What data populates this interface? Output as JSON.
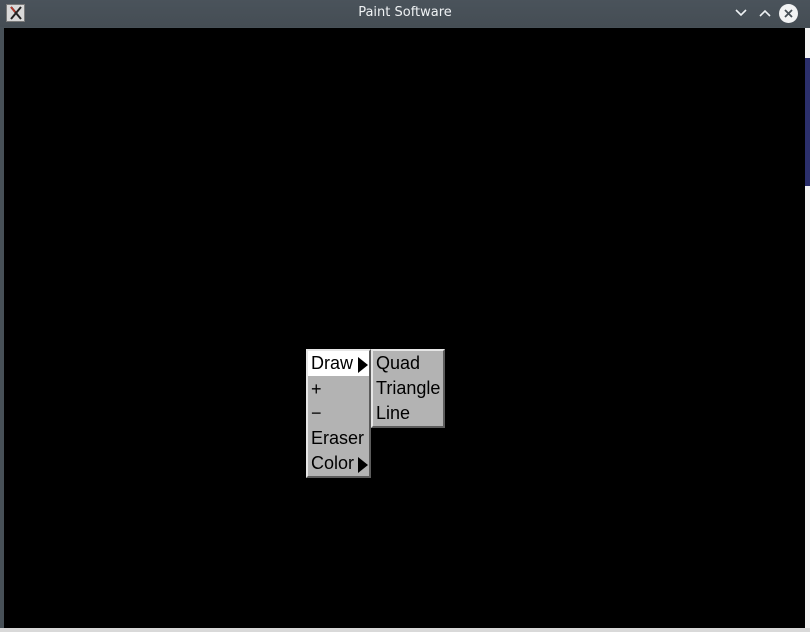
{
  "window": {
    "title": "Paint Software",
    "icon": "x-window-icon",
    "controls": [
      "minimize-icon",
      "maximize-icon",
      "close-icon"
    ]
  },
  "menu": {
    "items": [
      {
        "label": "Draw",
        "has_submenu": true,
        "selected": true
      },
      {
        "label": "+",
        "has_submenu": false
      },
      {
        "label": "−",
        "has_submenu": false
      },
      {
        "label": "Eraser",
        "has_submenu": false
      },
      {
        "label": "Color",
        "has_submenu": true
      }
    ]
  },
  "submenu": {
    "parent": "Draw",
    "items": [
      {
        "label": "Quad"
      },
      {
        "label": "Triangle"
      },
      {
        "label": "Line"
      }
    ]
  },
  "colors": {
    "canvas": "#000000",
    "menu_bg": "#b3b3b3",
    "menu_selected": "#ffffff",
    "titlebar": "#475057"
  }
}
